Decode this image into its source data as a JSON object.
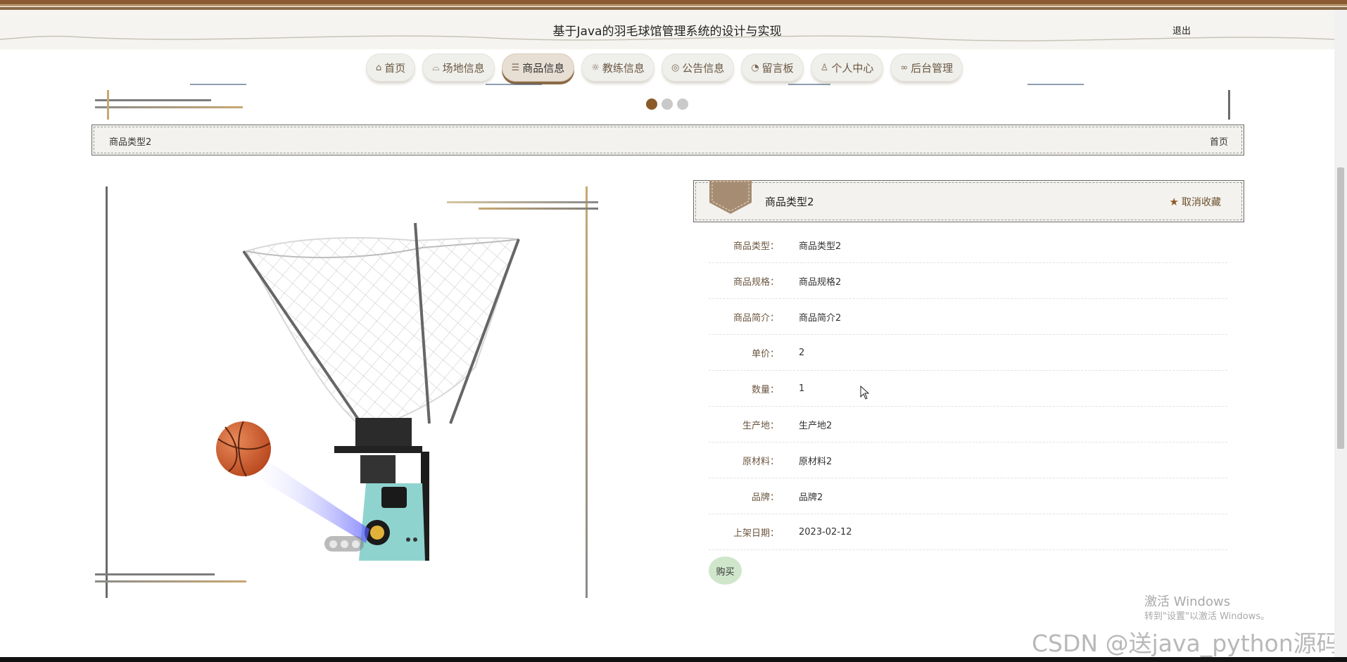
{
  "header": {
    "title": "基于Java的羽毛球馆管理系统的设计与实现",
    "logout_label": "退出"
  },
  "nav": {
    "items": [
      {
        "label": "首页",
        "icon": "home-icon"
      },
      {
        "label": "场地信息",
        "icon": "stadium-icon"
      },
      {
        "label": "商品信息",
        "icon": "layers-icon",
        "active": true
      },
      {
        "label": "教练信息",
        "icon": "sun-gear-icon"
      },
      {
        "label": "公告信息",
        "icon": "palette-icon"
      },
      {
        "label": "留言板",
        "icon": "gauge-icon"
      },
      {
        "label": "个人中心",
        "icon": "user-icon"
      },
      {
        "label": "后台管理",
        "icon": "link-icon"
      }
    ]
  },
  "carousel": {
    "slide_count": 3,
    "active_index": 0
  },
  "breadcrumb": {
    "current": "商品类型2",
    "home_link": "首页"
  },
  "product": {
    "title": "商品类型2",
    "favorite_label": "取消收藏",
    "image_dots": 3,
    "fields": [
      {
        "label": "商品类型：",
        "value": "商品类型2"
      },
      {
        "label": "商品规格：",
        "value": "商品规格2"
      },
      {
        "label": "商品简介：",
        "value": "商品简介2"
      },
      {
        "label": "单价：",
        "value": "2"
      },
      {
        "label": "数量：",
        "value": "1"
      },
      {
        "label": "生产地：",
        "value": "生产地2"
      },
      {
        "label": "原材料：",
        "value": "原材料2"
      },
      {
        "label": "品牌：",
        "value": "品牌2"
      },
      {
        "label": "上架日期：",
        "value": "2023-02-12"
      }
    ],
    "buy_label": "购买"
  },
  "overlays": {
    "activate_title": "激活 Windows",
    "activate_sub": "转到\"设置\"以激活 Windows。",
    "csdn_mark": "CSDN @送java_python源码"
  },
  "colors": {
    "accent_brown": "#8a5a28",
    "nav_text": "#6b5843",
    "buy_green": "#cfe6cb"
  }
}
